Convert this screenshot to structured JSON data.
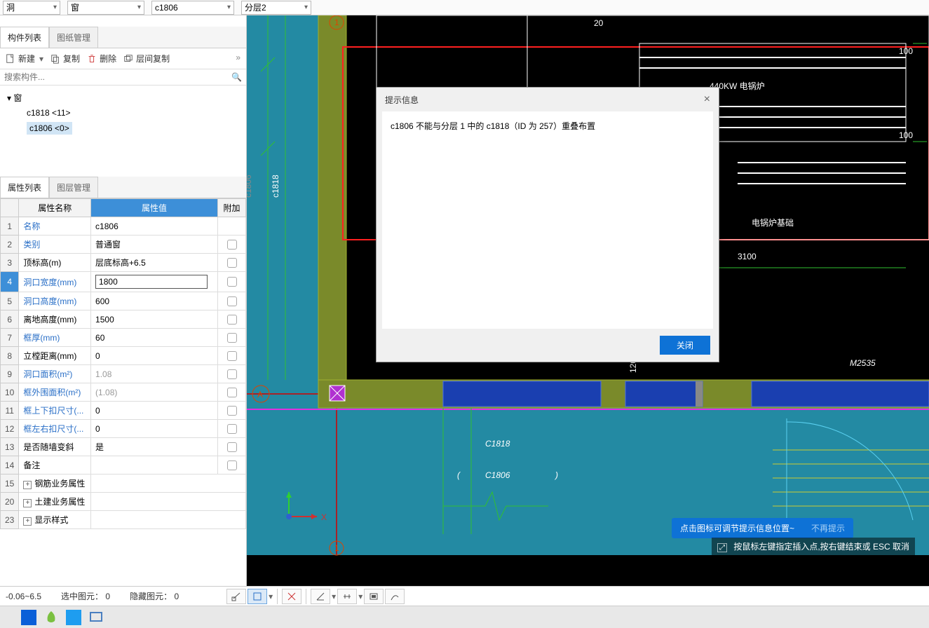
{
  "top_selectors": {
    "s1": "洞",
    "s2": "窗",
    "s3": "c1806",
    "s4": "分层2"
  },
  "left_tabs": {
    "components": "构件列表",
    "drawings": "图纸管理"
  },
  "toolbar": {
    "new": "新建",
    "copy": "复制",
    "delete": "删除",
    "layer_copy": "层间复制"
  },
  "search_placeholder": "搜索构件...",
  "tree": {
    "root": "窗",
    "items": [
      "c1818 <11>",
      "c1806 <0>"
    ],
    "selected_index": 1
  },
  "prop_tabs": {
    "attrs_list": "属性列表",
    "layer_mgmt": "图层管理"
  },
  "prop_headers": {
    "name": "属性名称",
    "value": "属性值",
    "extra": "附加"
  },
  "props": [
    {
      "n": "1",
      "name": "名称",
      "value": "c1806",
      "link": true
    },
    {
      "n": "2",
      "name": "类别",
      "value": "普通窗",
      "link": true,
      "chk": true
    },
    {
      "n": "3",
      "name": "顶标高(m)",
      "value": "层底标高+6.5",
      "chk": true
    },
    {
      "n": "4",
      "name": "洞口宽度(mm)",
      "value": "1800",
      "link": true,
      "chk": true,
      "sel": true
    },
    {
      "n": "5",
      "name": "洞口高度(mm)",
      "value": "600",
      "link": true,
      "chk": true
    },
    {
      "n": "6",
      "name": "离地高度(mm)",
      "value": "1500",
      "chk": true
    },
    {
      "n": "7",
      "name": "框厚(mm)",
      "value": "60",
      "link": true,
      "chk": true
    },
    {
      "n": "8",
      "name": "立樘距离(mm)",
      "value": "0",
      "chk": true
    },
    {
      "n": "9",
      "name": "洞口面积(m²)",
      "value": "1.08",
      "link": true,
      "gray": true,
      "chk": true
    },
    {
      "n": "10",
      "name": "框外围面积(m²)",
      "value": "(1.08)",
      "link": true,
      "gray": true,
      "chk": true
    },
    {
      "n": "11",
      "name": "框上下扣尺寸(...",
      "value": "0",
      "link": true,
      "chk": true
    },
    {
      "n": "12",
      "name": "框左右扣尺寸(...",
      "value": "0",
      "link": true,
      "chk": true
    },
    {
      "n": "13",
      "name": "是否随墙变斜",
      "value": "是",
      "chk": true
    },
    {
      "n": "14",
      "name": "备注",
      "value": "",
      "chk": true
    },
    {
      "n": "15",
      "name": "钢筋业务属性",
      "value": "",
      "group": true
    },
    {
      "n": "20",
      "name": "土建业务属性",
      "value": "",
      "group": true
    },
    {
      "n": "23",
      "name": "显示样式",
      "value": "",
      "group": true
    }
  ],
  "dialog": {
    "title": "提示信息",
    "body": "c1806 不能与分层 1 中的 c1818（ID 为 257）重叠布置",
    "close_btn": "关闭"
  },
  "canvas_text": {
    "c1806": "c1806",
    "c1818": "c1818",
    "kw": "440KW 电锅炉",
    "base": "电锅炉基础",
    "dim3100": "3100",
    "dim100a": "100",
    "dim100b": "100",
    "dim20": "20",
    "dim120": "120",
    "m2535": "M2535",
    "win_c1818": "C1818",
    "win_c1806": "C1806",
    "axis_a": "A",
    "axis_1t": "1",
    "axis_1b": "1",
    "coord_x": "X",
    "paren_l": "(",
    "paren_r": ")"
  },
  "hint": {
    "msg": "点击图标可调节提示信息位置~",
    "dismiss": "不再提示"
  },
  "cmd": "按鼠标左键指定插入点,按右键结束或 ESC 取消",
  "status": {
    "range": "-0.06~6.5",
    "sel": "选中图元：",
    "sel_n": "0",
    "hid": "隐藏图元：",
    "hid_n": "0"
  }
}
